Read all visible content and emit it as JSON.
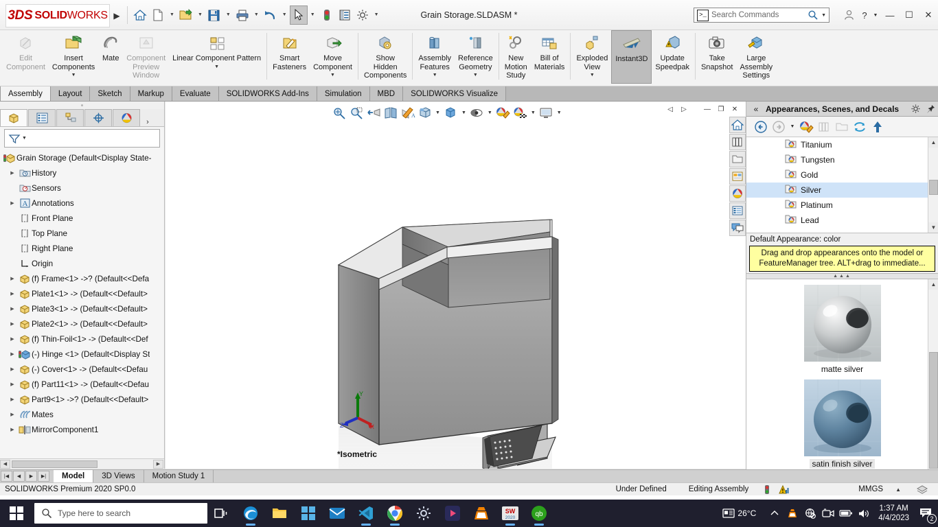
{
  "titlebar": {
    "logo_ds": "3DS",
    "logo_solid": "SOLID",
    "logo_works": "WORKS",
    "document_title": "Grain Storage.SLDASM *",
    "search_placeholder": "Search Commands",
    "buttons": [
      {
        "name": "home",
        "icon": "home-icon"
      },
      {
        "name": "new",
        "icon": "new-document-icon"
      },
      {
        "name": "open",
        "icon": "open-folder-icon"
      },
      {
        "name": "save",
        "icon": "save-icon"
      },
      {
        "name": "print",
        "icon": "print-icon"
      },
      {
        "name": "undo",
        "icon": "undo-icon"
      },
      {
        "name": "select",
        "icon": "arrow-cursor-icon"
      },
      {
        "name": "rebuild",
        "icon": "traffic-light-icon"
      },
      {
        "name": "file-properties",
        "icon": "file-properties-icon"
      },
      {
        "name": "options",
        "icon": "gear-icon"
      }
    ],
    "window_controls": [
      "minimize",
      "maximize",
      "close"
    ]
  },
  "ribbon": {
    "items": [
      {
        "label": "Edit\nComponent",
        "icon": "edit-component-icon",
        "disabled": true,
        "dropdown": false,
        "active": false
      },
      {
        "label": "Insert\nComponents",
        "icon": "insert-components-icon",
        "disabled": false,
        "dropdown": true,
        "active": false
      },
      {
        "label": "Mate",
        "icon": "mate-icon",
        "disabled": false,
        "dropdown": false,
        "active": false
      },
      {
        "label": "Component\nPreview\nWindow",
        "icon": "component-preview-icon",
        "disabled": true,
        "dropdown": false,
        "active": false
      },
      {
        "label": "Linear Component\nPattern",
        "icon": "linear-pattern-icon",
        "disabled": false,
        "dropdown": true,
        "active": false
      },
      {
        "label": "Smart\nFasteners",
        "icon": "smart-fasteners-icon",
        "disabled": false,
        "dropdown": false,
        "active": false
      },
      {
        "label": "Move\nComponent",
        "icon": "move-component-icon",
        "disabled": false,
        "dropdown": true,
        "active": false
      },
      {
        "label": "Show\nHidden\nComponents",
        "icon": "show-hidden-components-icon",
        "disabled": false,
        "dropdown": false,
        "active": false
      },
      {
        "label": "Assembly\nFeatures",
        "icon": "assembly-features-icon",
        "disabled": false,
        "dropdown": true,
        "active": false
      },
      {
        "label": "Reference\nGeometry",
        "icon": "reference-geometry-icon",
        "disabled": false,
        "dropdown": true,
        "active": false
      },
      {
        "label": "New\nMotion\nStudy",
        "icon": "new-motion-study-icon",
        "disabled": false,
        "dropdown": false,
        "active": false
      },
      {
        "label": "Bill of\nMaterials",
        "icon": "bill-of-materials-icon",
        "disabled": false,
        "dropdown": false,
        "active": false
      },
      {
        "label": "Exploded\nView",
        "icon": "exploded-view-icon",
        "disabled": false,
        "dropdown": true,
        "active": false
      },
      {
        "label": "Instant3D",
        "icon": "instant3d-icon",
        "disabled": false,
        "dropdown": false,
        "active": true
      },
      {
        "label": "Update\nSpeedpak",
        "icon": "update-speedpak-icon",
        "disabled": false,
        "dropdown": false,
        "active": false
      },
      {
        "label": "Take\nSnapshot",
        "icon": "camera-icon",
        "disabled": false,
        "dropdown": false,
        "active": false
      },
      {
        "label": "Large\nAssembly\nSettings",
        "icon": "large-assembly-icon",
        "disabled": false,
        "dropdown": false,
        "active": false
      }
    ]
  },
  "command_tabs": [
    {
      "label": "Assembly",
      "active": true
    },
    {
      "label": "Layout",
      "active": false
    },
    {
      "label": "Sketch",
      "active": false
    },
    {
      "label": "Markup",
      "active": false
    },
    {
      "label": "Evaluate",
      "active": false
    },
    {
      "label": "SOLIDWORKS Add-Ins",
      "active": false
    },
    {
      "label": "Simulation",
      "active": false
    },
    {
      "label": "MBD",
      "active": false
    },
    {
      "label": "SOLIDWORKS Visualize",
      "active": false
    }
  ],
  "feature_manager": {
    "tabs": [
      "feature-tree-tab",
      "property-manager-tab",
      "configuration-manager-tab",
      "dimxpert-tab",
      "appearances-tab"
    ],
    "filter_placeholder": "",
    "tree": [
      {
        "label": "Grain Storage  (Default<Display State-",
        "icon": "assembly-icon",
        "arrow": false,
        "indent": 0
      },
      {
        "label": "History",
        "icon": "history-icon",
        "arrow": true,
        "indent": 1
      },
      {
        "label": "Sensors",
        "icon": "sensors-icon",
        "arrow": false,
        "indent": 1
      },
      {
        "label": "Annotations",
        "icon": "annotations-icon",
        "arrow": true,
        "indent": 1
      },
      {
        "label": "Front Plane",
        "icon": "plane-icon",
        "arrow": false,
        "indent": 1
      },
      {
        "label": "Top Plane",
        "icon": "plane-icon",
        "arrow": false,
        "indent": 1
      },
      {
        "label": "Right Plane",
        "icon": "plane-icon",
        "arrow": false,
        "indent": 1
      },
      {
        "label": "Origin",
        "icon": "origin-icon",
        "arrow": false,
        "indent": 1
      },
      {
        "label": "(f) Frame<1> ->? (Default<<Defa",
        "icon": "part-icon",
        "arrow": true,
        "indent": 1
      },
      {
        "label": "Plate1<1> -> (Default<<Default>",
        "icon": "part-icon",
        "arrow": true,
        "indent": 1
      },
      {
        "label": "Plate3<1> -> (Default<<Default>",
        "icon": "part-icon",
        "arrow": true,
        "indent": 1
      },
      {
        "label": "Plate2<1> -> (Default<<Default>",
        "icon": "part-icon",
        "arrow": true,
        "indent": 1
      },
      {
        "label": "(f) Thin-Foil<1> -> (Default<<Def",
        "icon": "part-icon",
        "arrow": true,
        "indent": 1
      },
      {
        "label": "(-) Hinge <1> (Default<Display St",
        "icon": "subassembly-icon",
        "arrow": true,
        "indent": 1
      },
      {
        "label": "(-) Cover<1> -> (Default<<Defau",
        "icon": "part-icon",
        "arrow": true,
        "indent": 1
      },
      {
        "label": "(f) Part11<1> -> (Default<<Defau",
        "icon": "part-icon",
        "arrow": true,
        "indent": 1
      },
      {
        "label": "Part9<1> ->? (Default<<Default>",
        "icon": "part-icon",
        "arrow": true,
        "indent": 1
      },
      {
        "label": "Mates",
        "icon": "mates-icon",
        "arrow": true,
        "indent": 1
      },
      {
        "label": "MirrorComponent1",
        "icon": "mirror-component-icon",
        "arrow": true,
        "indent": 1
      }
    ]
  },
  "graphics": {
    "view_orientation_label": "*Isometric",
    "triad_axes": [
      "X",
      "Y",
      "Z"
    ],
    "heads_up_tools": [
      "zoom-to-fit-icon",
      "zoom-to-area-icon",
      "previous-view-icon",
      "section-view-icon",
      "view-orientation-icon",
      "display-style-icon",
      "hide-show-items-icon",
      "edit-appearance-icon",
      "apply-scene-icon",
      "view-settings-icon"
    ],
    "right_tabs": [
      "home-icon",
      "design-library-icon",
      "file-explorer-icon",
      "view-palette-icon",
      "appearances-icon",
      "custom-properties-icon",
      "solidworks-forum-icon"
    ]
  },
  "task_pane": {
    "title": "Appearances, Scenes, and Decals",
    "collapse_icon": "double-chevron-left-icon",
    "settings_icon": "gear-icon",
    "pin_icon": "pin-icon",
    "toolbar": [
      "back-icon",
      "forward-icon",
      "dropdown-caret",
      "appearances-icon",
      "decals-icon",
      "new-folder-icon",
      "refresh-icon",
      "up-level-icon"
    ],
    "folders": [
      {
        "label": "Titanium",
        "selected": false
      },
      {
        "label": "Tungsten",
        "selected": false
      },
      {
        "label": "Gold",
        "selected": false
      },
      {
        "label": "Silver",
        "selected": true
      },
      {
        "label": "Platinum",
        "selected": false
      },
      {
        "label": "Lead",
        "selected": false
      }
    ],
    "caption": "Default Appearance: color",
    "tip": "Drag and drop appearances onto the model or FeatureManager tree.  ALT+drag to immediate...",
    "gallery": [
      {
        "label": "matte silver",
        "selected": false,
        "color": "#c9cccd"
      },
      {
        "label": "satin finish silver",
        "selected": true,
        "color": "#5f84a0"
      }
    ]
  },
  "document_tabs": {
    "nav": [
      "first",
      "previous",
      "next",
      "last"
    ],
    "tabs": [
      {
        "label": "Model",
        "active": true
      },
      {
        "label": "3D Views",
        "active": false
      },
      {
        "label": "Motion Study 1",
        "active": false
      }
    ]
  },
  "status_bar": {
    "version": "SOLIDWORKS Premium 2020 SP0.0",
    "state": "Under Defined",
    "mode": "Editing Assembly",
    "rebuild_icon": "traffic-light-icon",
    "overdefined_icon": "warning-icon",
    "units": "MMGS",
    "units_caret": "▲",
    "tray_icon": "layers-icon"
  },
  "taskbar": {
    "search_placeholder": "Type here to search",
    "apps": [
      {
        "name": "task-view-icon",
        "running": false
      },
      {
        "name": "edge-icon",
        "running": true
      },
      {
        "name": "file-explorer-icon",
        "running": false
      },
      {
        "name": "store-icon",
        "running": false
      },
      {
        "name": "mail-icon",
        "running": false
      },
      {
        "name": "vscode-icon",
        "running": true
      },
      {
        "name": "chrome-icon",
        "running": true
      },
      {
        "name": "settings-icon",
        "running": false
      },
      {
        "name": "media-player-icon",
        "running": false
      },
      {
        "name": "vlc-icon",
        "running": false
      },
      {
        "name": "solidworks-icon",
        "running": true
      },
      {
        "name": "qb-icon",
        "running": true
      }
    ],
    "tray": {
      "weather_icon": "news-weather-icon",
      "temperature": "26°C",
      "chevron": "^",
      "icons": [
        "vlc-tray-icon",
        "network-blocked-icon",
        "camera-tray-icon",
        "battery-icon",
        "volume-icon"
      ],
      "time": "1:37 AM",
      "date": "4/4/2023",
      "notifications_icon": "notifications-icon",
      "notifications_count": "2"
    }
  }
}
